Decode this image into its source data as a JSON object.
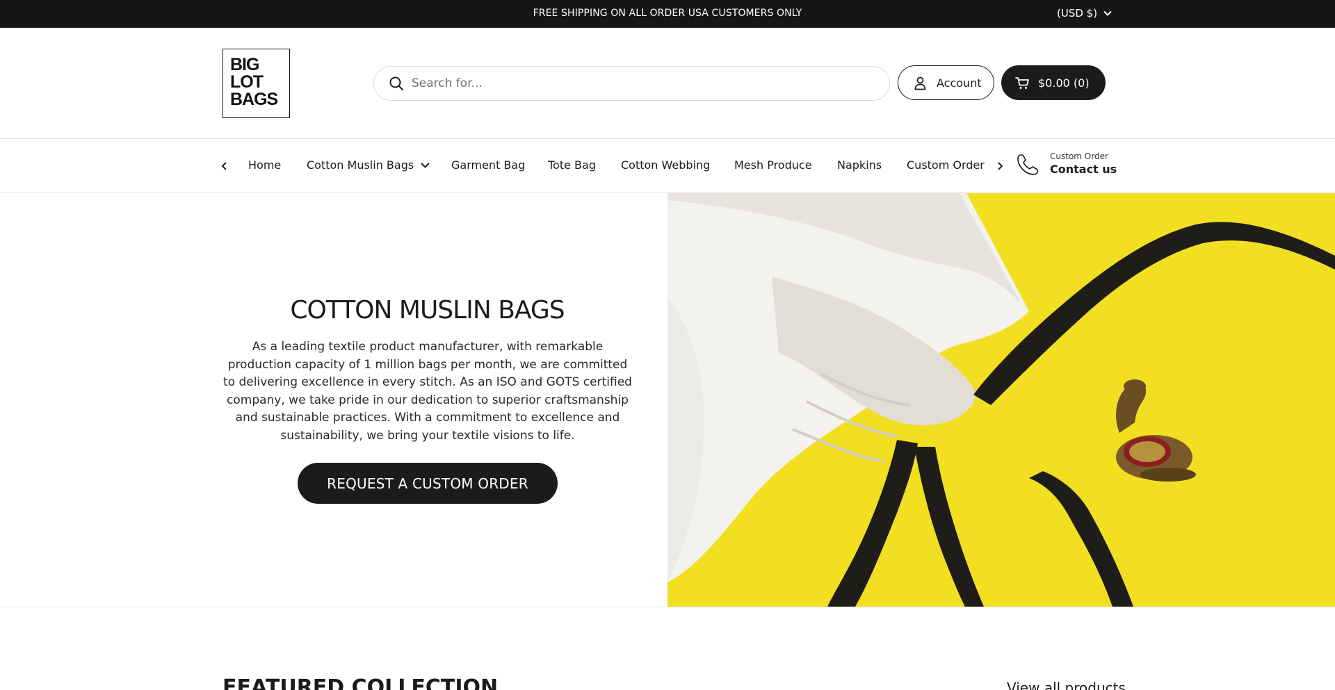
{
  "announcement": {
    "text": "FREE SHIPPING ON ALL ORDER USA CUSTOMERS ONLY",
    "currency": "(USD $)"
  },
  "header": {
    "logo_lines": [
      "BIG",
      "LOT",
      "BAGS"
    ],
    "search_placeholder": "Search for...",
    "account_label": "Account",
    "cart_label": "$0.00 (0)"
  },
  "nav": {
    "items": [
      {
        "label": "Home"
      },
      {
        "label": "Cotton Muslin Bags",
        "has_dropdown": true
      },
      {
        "label": "Garment Bag"
      },
      {
        "label": "Tote Bag"
      },
      {
        "label": "Cotton Webbing"
      },
      {
        "label": "Mesh Produce"
      },
      {
        "label": "Napkins"
      },
      {
        "label": "Custom Order"
      }
    ],
    "contact_small": "Custom Order",
    "contact_big": "Contact us"
  },
  "hero": {
    "title": "COTTON MUSLIN BAGS",
    "description": "As a leading textile product manufacturer, with remarkable production capacity of 1 million bags per month, we are committed to delivering excellence in every stitch. As an ISO and GOTS certified company, we take pride in our dedication to superior craftsmanship and sustainable practices. With a commitment to excellence and sustainability, we bring your textile visions to life.",
    "button_label": "REQUEST A CUSTOM ORDER",
    "image_background": "#f3e023"
  },
  "featured": {
    "title": "FEATURED COLLECTION",
    "view_all": "View all products"
  },
  "colors": {
    "dark": "#1b1b1b",
    "announcement_bg": "#161616",
    "hero_yellow": "#f3e023"
  }
}
